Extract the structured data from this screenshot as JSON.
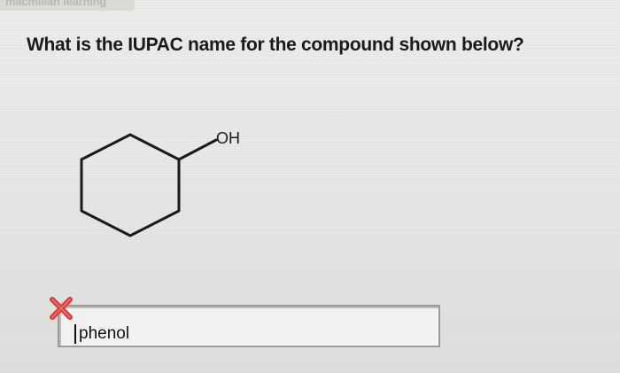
{
  "header": {
    "brand": "macmillan learning"
  },
  "question": {
    "text": "What is the IUPAC name for the compound shown below?"
  },
  "molecule": {
    "substituent_label": "OH"
  },
  "answer": {
    "value": "phenol",
    "status": "incorrect"
  },
  "colors": {
    "wrong_mark": "#d83a3a",
    "text": "#1a1a1a"
  }
}
